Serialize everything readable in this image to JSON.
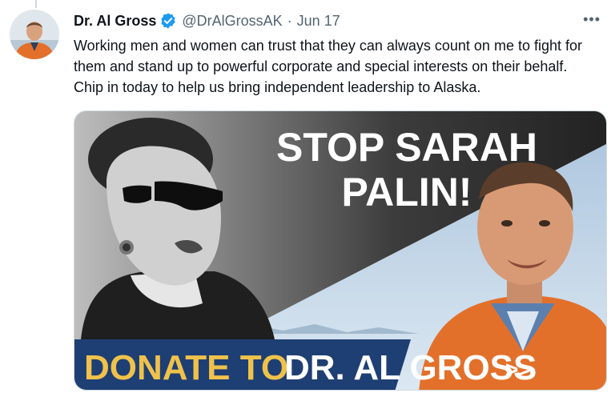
{
  "tweet": {
    "author": {
      "display_name": "Dr. Al Gross",
      "handle": "@DrAlGrossAK",
      "verified": true,
      "avatar_icon": "profile-photo"
    },
    "separator": "·",
    "date": "Jun 17",
    "more_icon": "more-horizontal-icon",
    "text": "Working men and women can trust that they can always count on me to fight for them and stand up to powerful corporate and special interests on their behalf. Chip in today to help us bring independent leadership to Alaska.",
    "media": {
      "headline_line1": "STOP SARAH",
      "headline_line2": "PALIN!",
      "banner_part1": "DONATE TO",
      "banner_part2": "DR. AL GROSS",
      "banner_arrow": ">>"
    }
  },
  "colors": {
    "verified_blue": "#1d9bf0",
    "secondary_text": "#536471",
    "banner_blue": "#1e3f73",
    "banner_gold": "#f0c24b",
    "jacket_orange": "#e3702a"
  }
}
